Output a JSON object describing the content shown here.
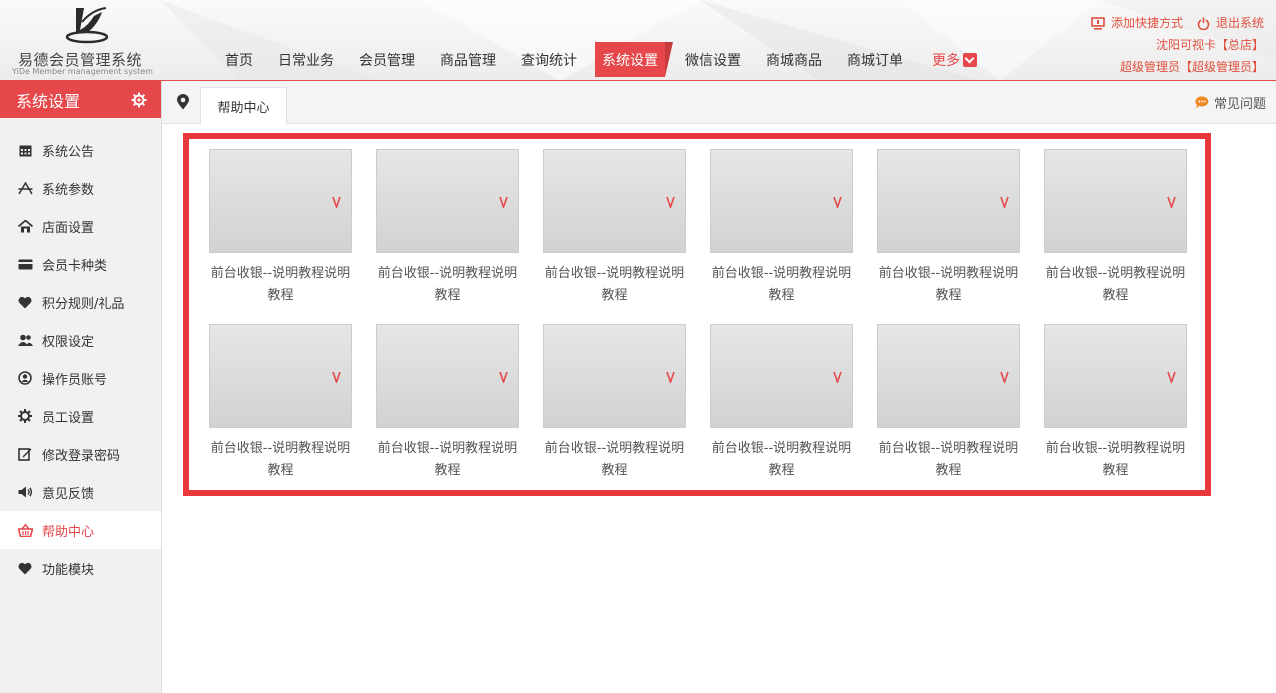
{
  "app": {
    "name": "易德会员管理系统",
    "subtitle": "YiDe Member management system"
  },
  "nav": {
    "items": [
      "首页",
      "日常业务",
      "会员管理",
      "商品管理",
      "查询统计",
      "系统设置",
      "微信设置",
      "商城商品",
      "商城订单"
    ],
    "active_index": 5,
    "more_label": "更多"
  },
  "top_right": {
    "add_shortcut": "添加快捷方式",
    "logout": "退出系统",
    "store": "沈阳可视卡【总店】",
    "user": "超级管理员【超级管理员】"
  },
  "sidebar": {
    "title": "系统设置",
    "items": [
      {
        "label": "系统公告",
        "icon": "calendar-icon"
      },
      {
        "label": "系统参数",
        "icon": "params-icon"
      },
      {
        "label": "店面设置",
        "icon": "home-icon"
      },
      {
        "label": "会员卡种类",
        "icon": "card-icon"
      },
      {
        "label": "积分规则/礼品",
        "icon": "heart-icon"
      },
      {
        "label": "权限设定",
        "icon": "users-icon"
      },
      {
        "label": "操作员账号",
        "icon": "user-circle-icon"
      },
      {
        "label": "员工设置",
        "icon": "gear-icon"
      },
      {
        "label": "修改登录密码",
        "icon": "edit-icon"
      },
      {
        "label": "意见反馈",
        "icon": "speaker-icon"
      },
      {
        "label": "帮助中心",
        "icon": "basket-icon"
      },
      {
        "label": "功能模块",
        "icon": "heart-icon"
      }
    ],
    "active_index": 10
  },
  "tabs": {
    "current": "帮助中心",
    "faq": "常见问题"
  },
  "help": {
    "items": [
      "前台收银--说明教程说明教程",
      "前台收银--说明教程说明教程",
      "前台收银--说明教程说明教程",
      "前台收银--说明教程说明教程",
      "前台收银--说明教程说明教程",
      "前台收银--说明教程说明教程",
      "前台收银--说明教程说明教程",
      "前台收银--说明教程说明教程",
      "前台收银--说明教程说明教程",
      "前台收银--说明教程说明教程",
      "前台收银--说明教程说明教程",
      "前台收银--说明教程说明教程"
    ]
  },
  "colors": {
    "accent": "#e5474a",
    "panel_border": "#e8383c",
    "top_link": "#e0503f"
  }
}
